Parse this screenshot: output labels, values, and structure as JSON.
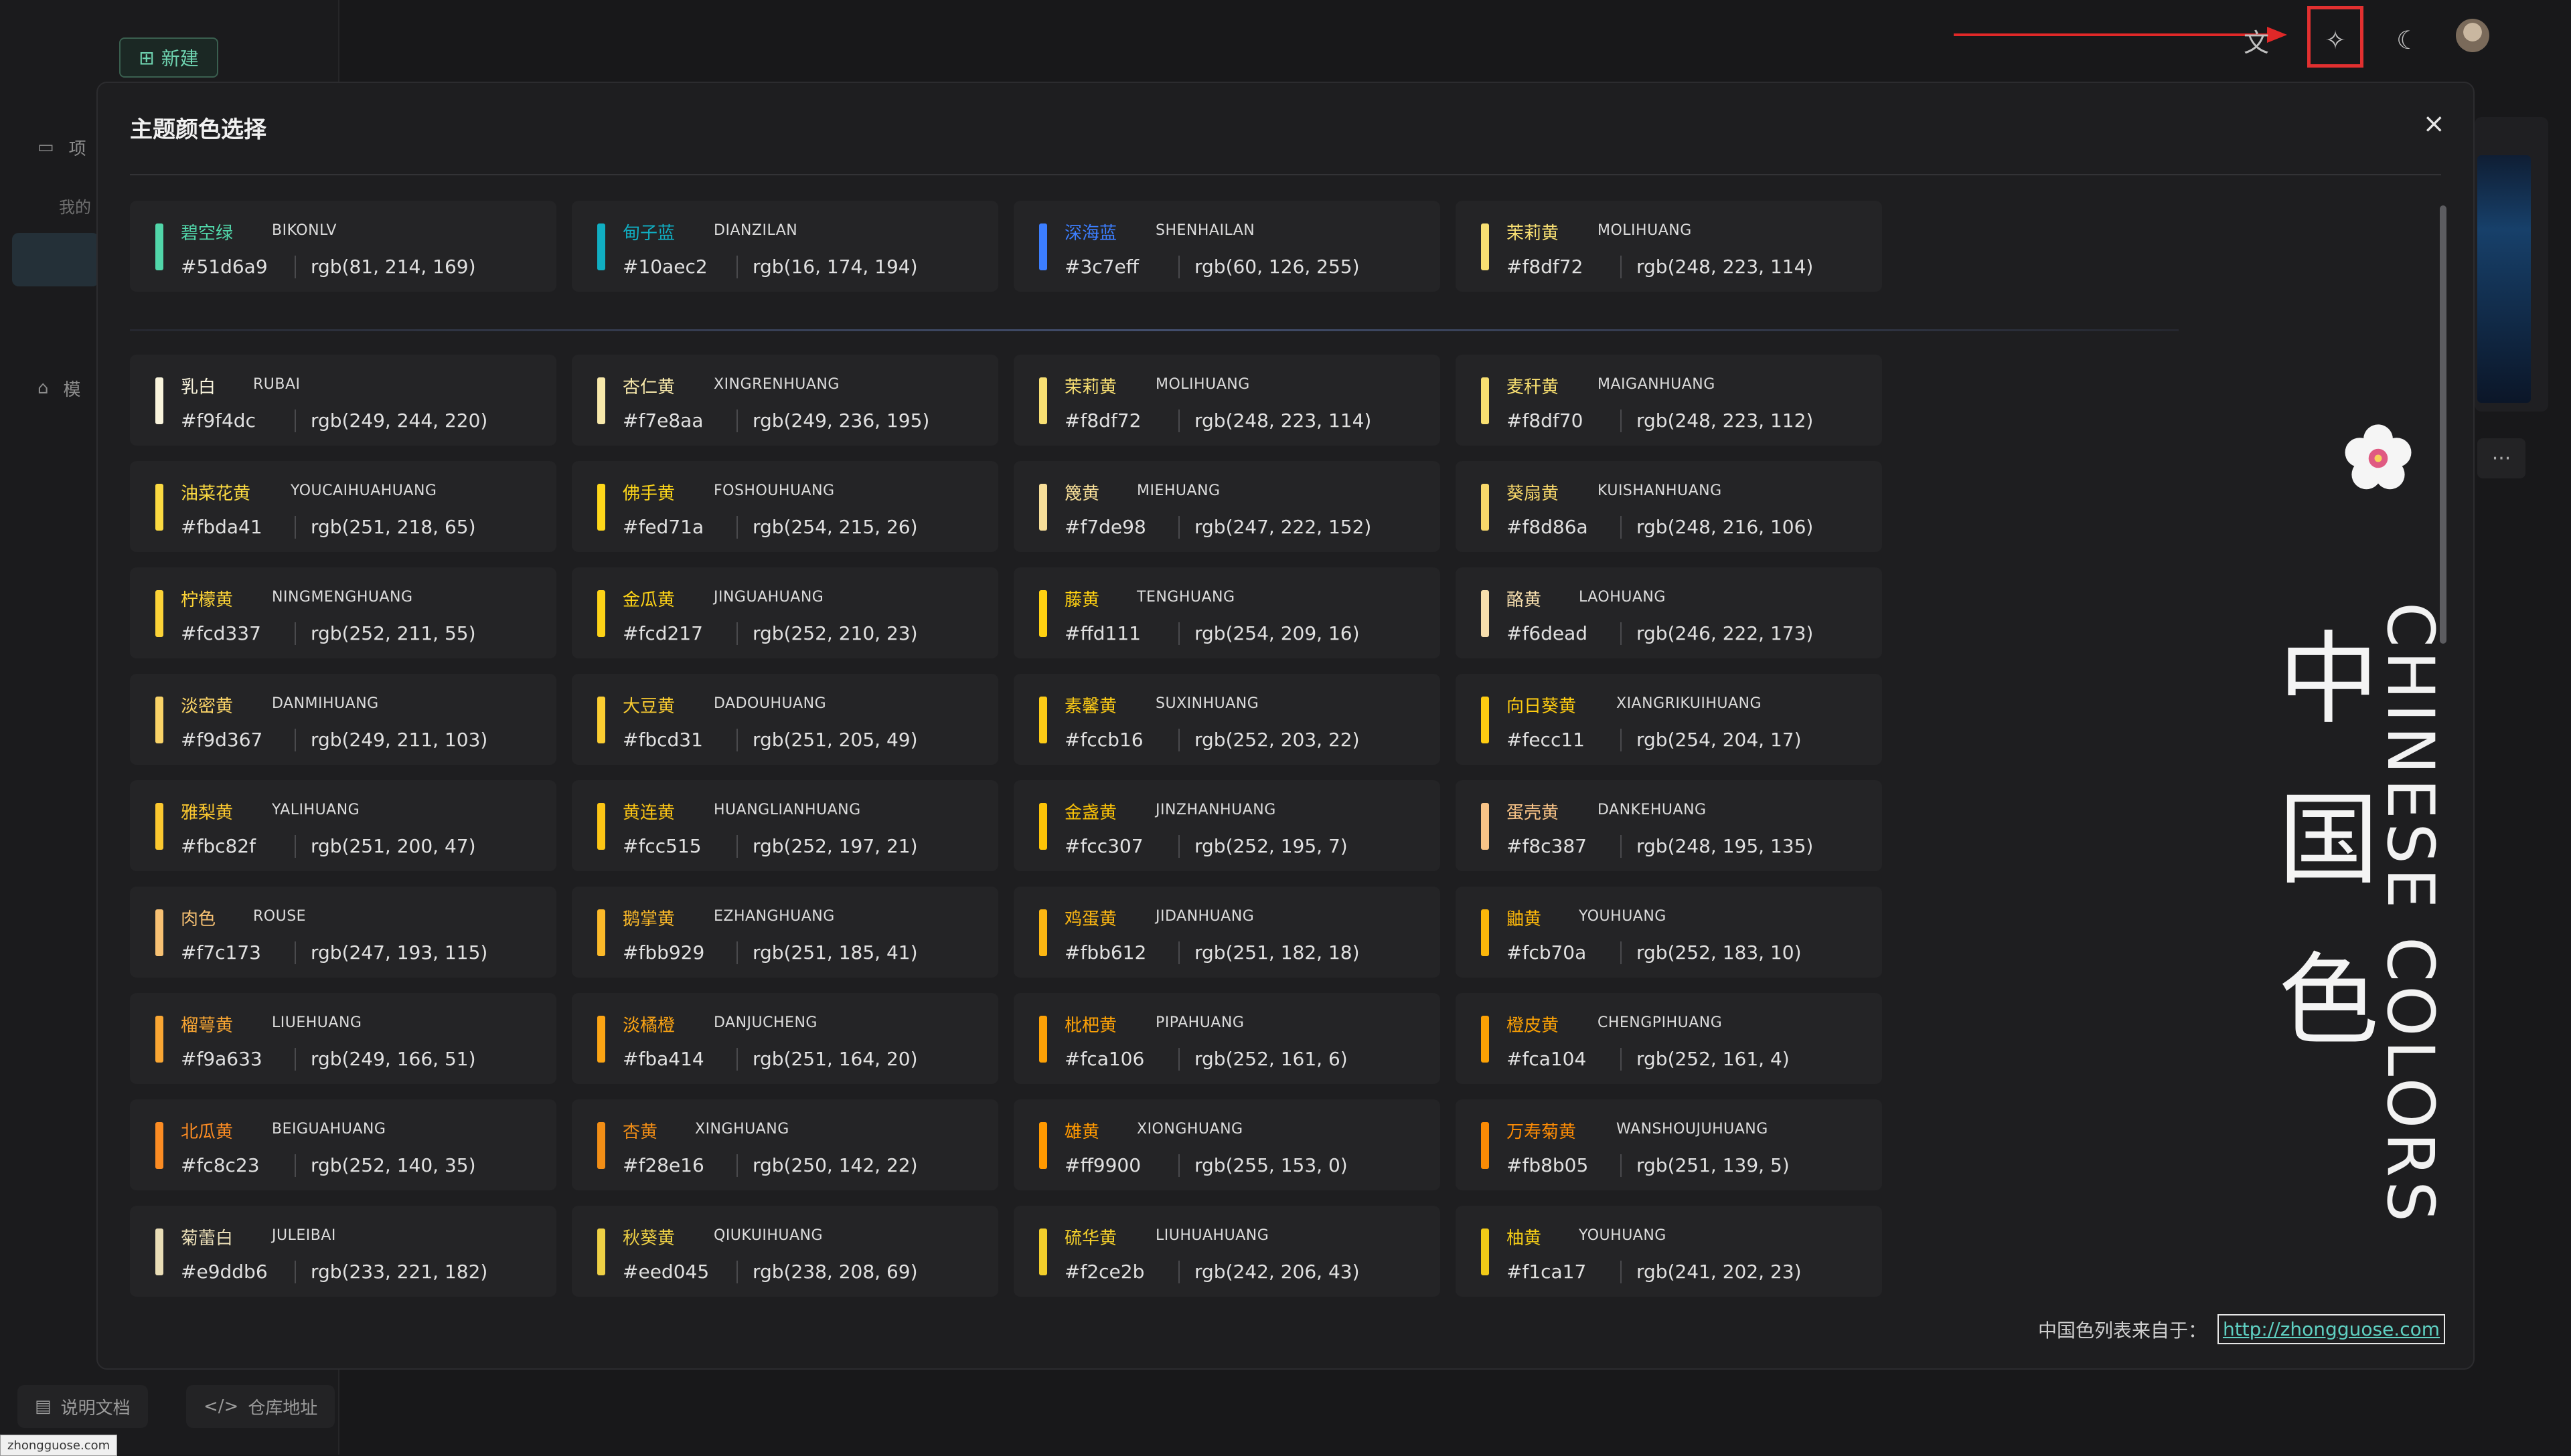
{
  "topbar": {
    "new_label": "新建"
  },
  "sidebar": {
    "items": [
      {
        "label": "项",
        "icon": "project-icon"
      },
      {
        "label": "我的"
      },
      {
        "label": "模",
        "icon": "store-icon"
      }
    ],
    "docs_label": "说明文档",
    "repo_label": "仓库地址"
  },
  "status_url": "zhongguose.com",
  "modal": {
    "title": "主题颜色选择",
    "close_glyph": "×",
    "source_label": "中国色列表来自于：",
    "source_link": "http://zhongguose.com",
    "brand_cn": [
      "中",
      "国",
      "色"
    ],
    "brand_en": "CHINESE COLORS"
  },
  "colors_top": [
    {
      "cn": "碧空绿",
      "py": "BIKONLV",
      "hex": "#51d6a9",
      "rgb": "rgb(81, 214, 169)"
    },
    {
      "cn": "甸子蓝",
      "py": "DIANZILAN",
      "hex": "#10aec2",
      "rgb": "rgb(16, 174, 194)"
    },
    {
      "cn": "深海蓝",
      "py": "SHENHAILAN",
      "hex": "#3c7eff",
      "rgb": "rgb(60, 126, 255)"
    },
    {
      "cn": "茉莉黄",
      "py": "MOLIHUANG",
      "hex": "#f8df72",
      "rgb": "rgb(248, 223, 114)"
    }
  ],
  "colors": [
    {
      "cn": "乳白",
      "py": "RUBAI",
      "hex": "#f9f4dc",
      "rgb": "rgb(249, 244, 220)"
    },
    {
      "cn": "杏仁黄",
      "py": "XINGRENHUANG",
      "hex": "#f7e8aa",
      "rgb": "rgb(249, 236, 195)"
    },
    {
      "cn": "茉莉黄",
      "py": "MOLIHUANG",
      "hex": "#f8df72",
      "rgb": "rgb(248, 223, 114)"
    },
    {
      "cn": "麦秆黄",
      "py": "MAIGANHUANG",
      "hex": "#f8df70",
      "rgb": "rgb(248, 223, 112)"
    },
    {
      "cn": "油菜花黄",
      "py": "YOUCAIHUAHUANG",
      "hex": "#fbda41",
      "rgb": "rgb(251, 218, 65)"
    },
    {
      "cn": "佛手黄",
      "py": "FOSHOUHUANG",
      "hex": "#fed71a",
      "rgb": "rgb(254, 215, 26)"
    },
    {
      "cn": "篾黄",
      "py": "MIEHUANG",
      "hex": "#f7de98",
      "rgb": "rgb(247, 222, 152)"
    },
    {
      "cn": "葵扇黄",
      "py": "KUISHANHUANG",
      "hex": "#f8d86a",
      "rgb": "rgb(248, 216, 106)"
    },
    {
      "cn": "柠檬黄",
      "py": "NINGMENGHUANG",
      "hex": "#fcd337",
      "rgb": "rgb(252, 211, 55)"
    },
    {
      "cn": "金瓜黄",
      "py": "JINGUAHUANG",
      "hex": "#fcd217",
      "rgb": "rgb(252, 210, 23)"
    },
    {
      "cn": "藤黄",
      "py": "TENGHUANG",
      "hex": "#ffd111",
      "rgb": "rgb(254, 209, 16)"
    },
    {
      "cn": "酪黄",
      "py": "LAOHUANG",
      "hex": "#f6dead",
      "rgb": "rgb(246, 222, 173)"
    },
    {
      "cn": "淡密黄",
      "py": "DANMIHUANG",
      "hex": "#f9d367",
      "rgb": "rgb(249, 211, 103)"
    },
    {
      "cn": "大豆黄",
      "py": "DADOUHUANG",
      "hex": "#fbcd31",
      "rgb": "rgb(251, 205, 49)"
    },
    {
      "cn": "素馨黄",
      "py": "SUXINHUANG",
      "hex": "#fccb16",
      "rgb": "rgb(252, 203, 22)"
    },
    {
      "cn": "向日葵黄",
      "py": "XIANGRIKUIHUANG",
      "hex": "#fecc11",
      "rgb": "rgb(254, 204, 17)"
    },
    {
      "cn": "雅梨黄",
      "py": "YALIHUANG",
      "hex": "#fbc82f",
      "rgb": "rgb(251, 200, 47)"
    },
    {
      "cn": "黄连黄",
      "py": "HUANGLIANHUANG",
      "hex": "#fcc515",
      "rgb": "rgb(252, 197, 21)"
    },
    {
      "cn": "金盏黄",
      "py": "JINZHANHUANG",
      "hex": "#fcc307",
      "rgb": "rgb(252, 195, 7)"
    },
    {
      "cn": "蛋壳黄",
      "py": "DANKEHUANG",
      "hex": "#f8c387",
      "rgb": "rgb(248, 195, 135)"
    },
    {
      "cn": "肉色",
      "py": "ROUSE",
      "hex": "#f7c173",
      "rgb": "rgb(247, 193, 115)"
    },
    {
      "cn": "鹅掌黄",
      "py": "EZHANGHUANG",
      "hex": "#fbb929",
      "rgb": "rgb(251, 185, 41)"
    },
    {
      "cn": "鸡蛋黄",
      "py": "JIDANHUANG",
      "hex": "#fbb612",
      "rgb": "rgb(251, 182, 18)"
    },
    {
      "cn": "鼬黄",
      "py": "YOUHUANG",
      "hex": "#fcb70a",
      "rgb": "rgb(252, 183, 10)"
    },
    {
      "cn": "榴萼黄",
      "py": "LIUEHUANG",
      "hex": "#f9a633",
      "rgb": "rgb(249, 166, 51)"
    },
    {
      "cn": "淡橘橙",
      "py": "DANJUCHENG",
      "hex": "#fba414",
      "rgb": "rgb(251, 164, 20)"
    },
    {
      "cn": "枇杷黄",
      "py": "PIPAHUANG",
      "hex": "#fca106",
      "rgb": "rgb(252, 161, 6)"
    },
    {
      "cn": "橙皮黄",
      "py": "CHENGPIHUANG",
      "hex": "#fca104",
      "rgb": "rgb(252, 161, 4)"
    },
    {
      "cn": "北瓜黄",
      "py": "BEIGUAHUANG",
      "hex": "#fc8c23",
      "rgb": "rgb(252, 140, 35)"
    },
    {
      "cn": "杏黄",
      "py": "XINGHUANG",
      "hex": "#f28e16",
      "rgb": "rgb(250, 142, 22)"
    },
    {
      "cn": "雄黄",
      "py": "XIONGHUANG",
      "hex": "#ff9900",
      "rgb": "rgb(255, 153, 0)"
    },
    {
      "cn": "万寿菊黄",
      "py": "WANSHOUJUHUANG",
      "hex": "#fb8b05",
      "rgb": "rgb(251, 139, 5)"
    },
    {
      "cn": "菊蕾白",
      "py": "JULEIBAI",
      "hex": "#e9ddb6",
      "rgb": "rgb(233, 221, 182)"
    },
    {
      "cn": "秋葵黄",
      "py": "QIUKUIHUANG",
      "hex": "#eed045",
      "rgb": "rgb(238, 208, 69)"
    },
    {
      "cn": "硫华黄",
      "py": "LIUHUAHUANG",
      "hex": "#f2ce2b",
      "rgb": "rgb(242, 206, 43)"
    },
    {
      "cn": "柚黄",
      "py": "YOUHUANG",
      "hex": "#f1ca17",
      "rgb": "rgb(241, 202, 23)"
    }
  ]
}
